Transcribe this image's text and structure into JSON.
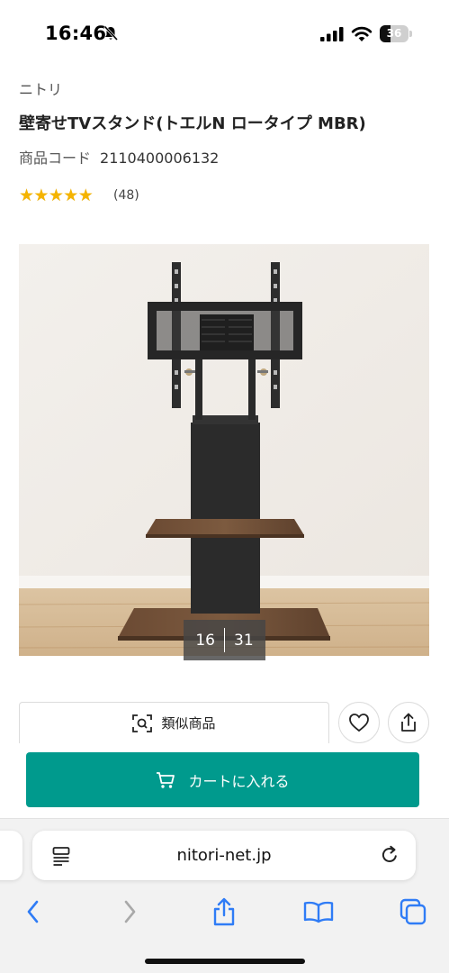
{
  "status_bar": {
    "time": "16:46",
    "battery_level": "36",
    "battery_fraction": 0.36,
    "icons": [
      "bell-slash-icon",
      "signal-icon",
      "wifi-icon",
      "battery-icon"
    ]
  },
  "product": {
    "brand": "ニトリ",
    "title": "壁寄せTVスタンド(トエルN ロータイプ MBR)",
    "code_label": "商品コード",
    "code_value": "2110400006132",
    "rating": {
      "stars_text": "★★★★★",
      "value_fraction": 0.9,
      "review_count": "(48)"
    },
    "image": {
      "alt": "壁寄せTVスタンド",
      "counter_current": "16",
      "counter_total": "31"
    }
  },
  "actions": {
    "similar_label": "類似商品",
    "cart_label": "カートに入れる",
    "icons": [
      "scan-icon",
      "heart-icon",
      "share-icon",
      "cart-icon"
    ]
  },
  "browser": {
    "url": "nitori-net.jp",
    "icons": [
      "reader-icon",
      "reload-icon",
      "back-icon",
      "forward-icon",
      "share-icon",
      "bookmarks-icon",
      "tabs-icon"
    ]
  },
  "colors": {
    "cart_button": "#009a8d",
    "browser_blue": "#2f7cf6",
    "star": "#f5b400"
  }
}
